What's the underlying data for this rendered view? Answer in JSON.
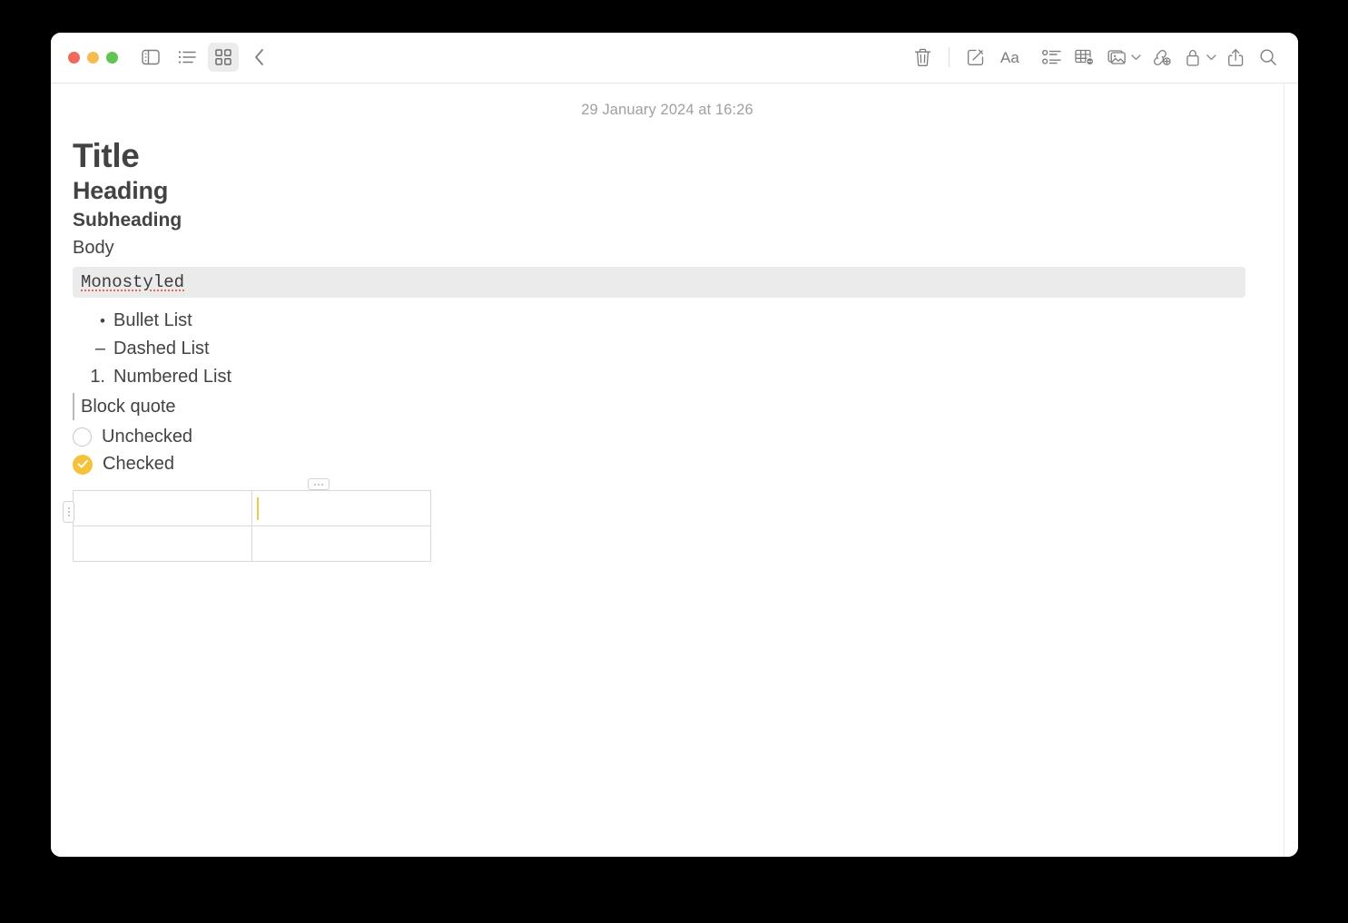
{
  "window": {
    "traffic_lights": [
      {
        "name": "close",
        "color": "#ee6a5f"
      },
      {
        "name": "minimize",
        "color": "#f5bd4f"
      },
      {
        "name": "maximize",
        "color": "#61c454"
      }
    ]
  },
  "toolbar": {
    "left_items": [
      {
        "icon": "sidebar-toggle-icon",
        "label": "Sidebar",
        "active": false
      },
      {
        "icon": "list-view-icon",
        "label": "List View",
        "active": false
      },
      {
        "icon": "grid-view-icon",
        "label": "Gallery View",
        "active": true
      },
      {
        "icon": "back-chevron-icon",
        "label": "Back",
        "active": false
      }
    ],
    "right_items": [
      {
        "icon": "trash-icon",
        "label": "Delete"
      },
      {
        "icon": "compose-icon",
        "label": "New Note"
      },
      {
        "icon": "format-aa-icon",
        "label": "Aa"
      },
      {
        "icon": "checklist-icon",
        "label": "Checklist"
      },
      {
        "icon": "table-icon",
        "label": "Table"
      },
      {
        "icon": "media-icon",
        "label": "Media",
        "chevron": true
      },
      {
        "icon": "link-icon",
        "label": "Add Link"
      },
      {
        "icon": "lock-icon",
        "label": "Lock Note",
        "chevron": true
      },
      {
        "icon": "share-icon",
        "label": "Share"
      },
      {
        "icon": "search-icon",
        "label": "Search"
      }
    ]
  },
  "note": {
    "date": "29 January 2024 at 16:26",
    "title": "Title",
    "heading": "Heading",
    "subheading": "Subheading",
    "body": "Body",
    "monostyled": "Monostyled",
    "lists": [
      {
        "marker": "•",
        "text": "Bullet List"
      },
      {
        "marker": "–",
        "text": "Dashed List"
      },
      {
        "marker": "1.",
        "text": "Numbered List"
      }
    ],
    "blockquote": "Block quote",
    "checklist": [
      {
        "label": "Unchecked",
        "checked": false
      },
      {
        "label": "Checked",
        "checked": true
      }
    ],
    "table": {
      "rows": [
        [
          "",
          ""
        ],
        [
          "",
          ""
        ]
      ],
      "caret_cell": {
        "row": 0,
        "col": 1
      },
      "caret_color": "#ecc94b"
    }
  }
}
